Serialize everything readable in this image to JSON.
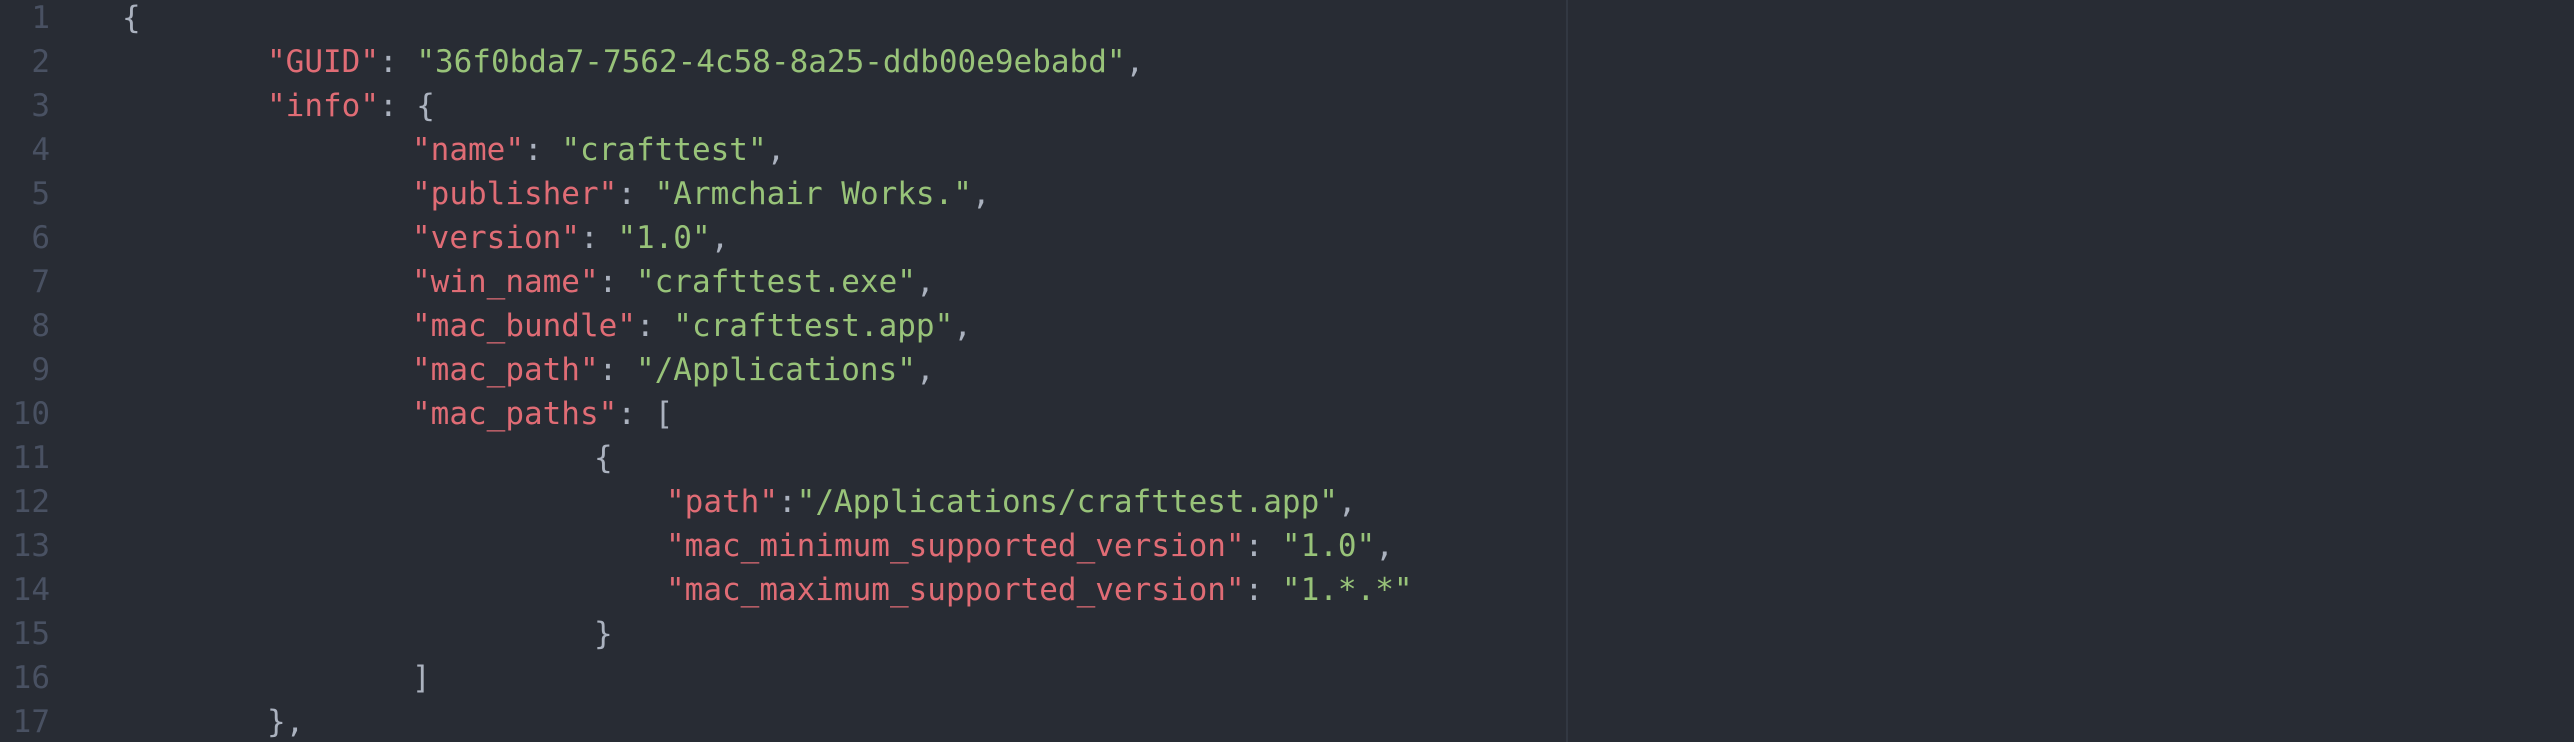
{
  "editor": {
    "language": "json",
    "theme_colors": {
      "background": "#282c34",
      "line_number": "#495162",
      "key": "#e06c75",
      "string": "#98c379",
      "punctuation": "#abb2bf",
      "wrap_guide": "#323842"
    },
    "lines": [
      {
        "n": "1",
        "indent": 0,
        "tokens": [
          {
            "t": "{",
            "k": "punct"
          }
        ]
      },
      {
        "n": "2",
        "indent": 1,
        "tokens": [
          {
            "t": "\"GUID\"",
            "k": "key"
          },
          {
            "t": ": ",
            "k": "punct"
          },
          {
            "t": "\"36f0bda7-7562-4c58-8a25-ddb00e9ebabd\"",
            "k": "str"
          },
          {
            "t": ",",
            "k": "punct"
          }
        ]
      },
      {
        "n": "3",
        "indent": 1,
        "tokens": [
          {
            "t": "\"info\"",
            "k": "key"
          },
          {
            "t": ": {",
            "k": "punct"
          }
        ]
      },
      {
        "n": "4",
        "indent": 2,
        "tokens": [
          {
            "t": "\"name\"",
            "k": "key"
          },
          {
            "t": ": ",
            "k": "punct"
          },
          {
            "t": "\"crafttest\"",
            "k": "str"
          },
          {
            "t": ",",
            "k": "punct"
          }
        ]
      },
      {
        "n": "5",
        "indent": 2,
        "tokens": [
          {
            "t": "\"publisher\"",
            "k": "key"
          },
          {
            "t": ": ",
            "k": "punct"
          },
          {
            "t": "\"Armchair Works.\"",
            "k": "str"
          },
          {
            "t": ",",
            "k": "punct"
          }
        ]
      },
      {
        "n": "6",
        "indent": 2,
        "tokens": [
          {
            "t": "\"version\"",
            "k": "key"
          },
          {
            "t": ": ",
            "k": "punct"
          },
          {
            "t": "\"1.0\"",
            "k": "str"
          },
          {
            "t": ",",
            "k": "punct"
          }
        ]
      },
      {
        "n": "7",
        "indent": 2,
        "tokens": [
          {
            "t": "\"win_name\"",
            "k": "key"
          },
          {
            "t": ": ",
            "k": "punct"
          },
          {
            "t": "\"crafttest.exe\"",
            "k": "str"
          },
          {
            "t": ",",
            "k": "punct"
          }
        ]
      },
      {
        "n": "8",
        "indent": 2,
        "tokens": [
          {
            "t": "\"mac_bundle\"",
            "k": "key"
          },
          {
            "t": ": ",
            "k": "punct"
          },
          {
            "t": "\"crafttest.app\"",
            "k": "str"
          },
          {
            "t": ",",
            "k": "punct"
          }
        ]
      },
      {
        "n": "9",
        "indent": 2,
        "tokens": [
          {
            "t": "\"mac_path\"",
            "k": "key"
          },
          {
            "t": ": ",
            "k": "punct"
          },
          {
            "t": "\"/Applications\"",
            "k": "str"
          },
          {
            "t": ",",
            "k": "punct"
          }
        ]
      },
      {
        "n": "10",
        "indent": 2,
        "tokens": [
          {
            "t": "\"mac_paths\"",
            "k": "key"
          },
          {
            "t": ": [",
            "k": "punct"
          }
        ]
      },
      {
        "n": "11",
        "indent": 3,
        "tokens": [
          {
            "t": "{",
            "k": "punct"
          }
        ]
      },
      {
        "n": "12",
        "indent": 4,
        "tokens": [
          {
            "t": "\"path\"",
            "k": "key"
          },
          {
            "t": ":",
            "k": "punct"
          },
          {
            "t": "\"/Applications/crafttest.app\"",
            "k": "str"
          },
          {
            "t": ",",
            "k": "punct"
          }
        ]
      },
      {
        "n": "13",
        "indent": 4,
        "tokens": [
          {
            "t": "\"mac_minimum_supported_version\"",
            "k": "key"
          },
          {
            "t": ": ",
            "k": "punct"
          },
          {
            "t": "\"1.0\"",
            "k": "str"
          },
          {
            "t": ",",
            "k": "punct"
          }
        ]
      },
      {
        "n": "14",
        "indent": 4,
        "tokens": [
          {
            "t": "\"mac_maximum_supported_version\"",
            "k": "key"
          },
          {
            "t": ": ",
            "k": "punct"
          },
          {
            "t": "\"1.*.*\"",
            "k": "str"
          }
        ]
      },
      {
        "n": "15",
        "indent": 3,
        "tokens": [
          {
            "t": "}",
            "k": "punct"
          }
        ]
      },
      {
        "n": "16",
        "indent": 2,
        "tokens": [
          {
            "t": "]",
            "k": "punct"
          }
        ]
      },
      {
        "n": "17",
        "indent": 1,
        "tokens": [
          {
            "t": "},",
            "k": "punct"
          }
        ]
      }
    ]
  }
}
